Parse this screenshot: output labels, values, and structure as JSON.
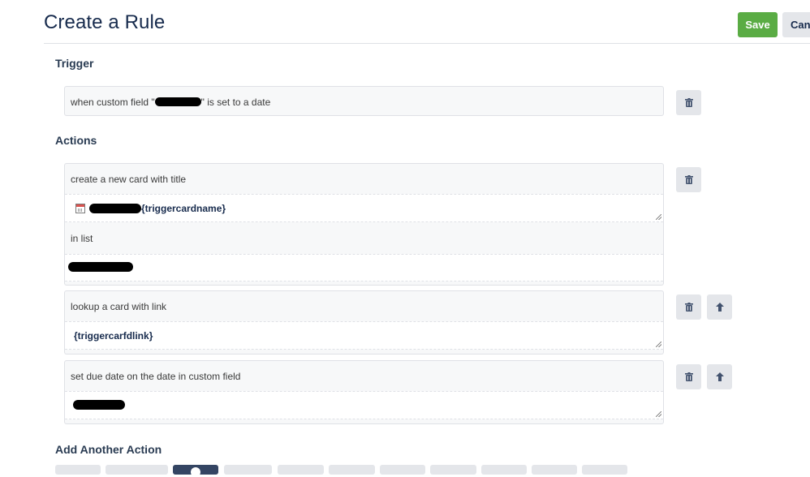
{
  "header": {
    "title": "Create a Rule",
    "save_label": "Save",
    "cancel_label": "Can"
  },
  "trigger": {
    "heading": "Trigger",
    "text_before": "when custom field \"",
    "text_after": "\" is set to a date"
  },
  "actions": {
    "heading": "Actions",
    "create_card": {
      "label": "create a new card with title",
      "title_value": "{triggercardname}",
      "list_label": "in list"
    },
    "lookup_card": {
      "label": "lookup a card with link",
      "link_value": "{triggercarfdlink}"
    },
    "set_due": {
      "label": "set due date on the date in custom field"
    }
  },
  "add_action": {
    "heading": "Add Another Action",
    "tab_count": 11,
    "active_tab_index": 2
  },
  "icons": {
    "trash": "trash-icon",
    "arrow_up": "arrow-up-icon",
    "calendar": "calendar-icon"
  },
  "colors": {
    "save": "#5aac44",
    "neutral_button": "#e4e6ea",
    "heading": "#172b4d"
  }
}
